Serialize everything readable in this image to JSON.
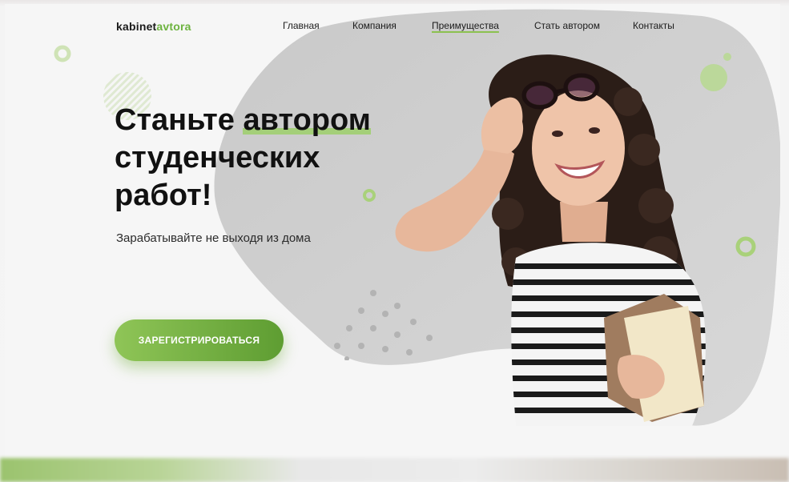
{
  "header": {
    "logo_part1": "kabinet",
    "logo_part2": "avtora",
    "nav": [
      {
        "label": "Главная"
      },
      {
        "label": "Компания"
      },
      {
        "label": "Преимущества",
        "active": true
      },
      {
        "label": "Стать автором"
      },
      {
        "label": "Контакты"
      }
    ]
  },
  "hero": {
    "title_line1_a": "Станьте",
    "title_line1_b": "автором",
    "title_line2": "студенческих",
    "title_line3": "работ!",
    "subtitle": "Зарабатывайте не выходя из дома",
    "cta_label": "ЗАРЕГИСТРИРОВАТЬСЯ"
  },
  "colors": {
    "accent": "#8cc150",
    "accent_dark": "#5e9d32",
    "blob": "#cfcfcf",
    "text": "#111111"
  }
}
